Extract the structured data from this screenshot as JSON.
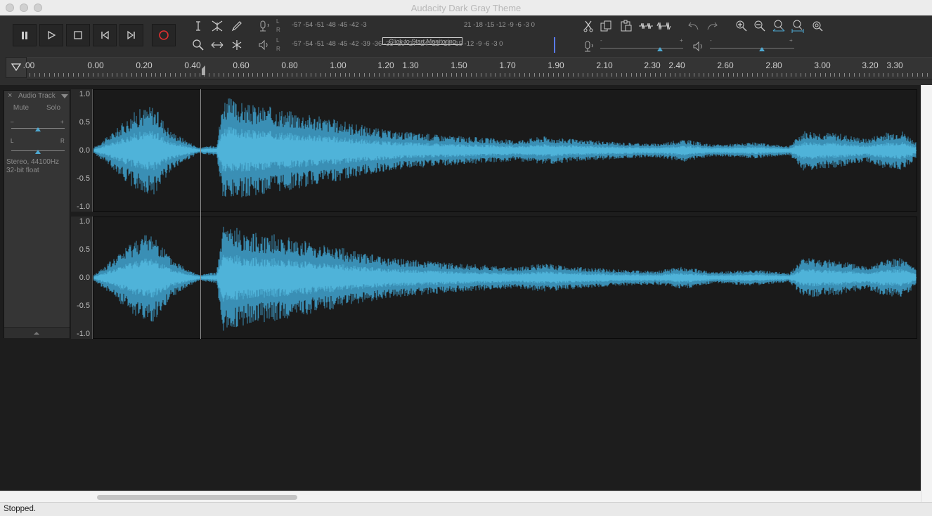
{
  "window": {
    "title": "Audacity Dark Gray Theme"
  },
  "transport": {
    "buttons": [
      {
        "name": "pause-button",
        "icon": "pause-icon"
      },
      {
        "name": "play-button",
        "icon": "play-icon"
      },
      {
        "name": "stop-button",
        "icon": "stop-icon"
      },
      {
        "name": "skip-to-start-button",
        "icon": "skip-start-icon"
      },
      {
        "name": "skip-to-end-button",
        "icon": "skip-end-icon"
      },
      {
        "name": "record-button",
        "icon": "record-icon"
      }
    ],
    "record_color": "#e03030"
  },
  "tools": [
    "selection-tool-icon",
    "envelope-tool-icon",
    "draw-tool-icon",
    "zoom-tool-icon",
    "timeshift-tool-icon",
    "multi-tool-icon"
  ],
  "meters": {
    "record_scale": "-57 -54 -51 -48 -45 -42 -3",
    "record_scale_right": "21 -18 -15 -12 -9 -6 -3 0",
    "monitor_label": "Click to Start Monitoring",
    "playback_scale": "-57 -54 -51 -48 -45 -42 -39 -36 -33 -30 -27 -24 -21 -18 -15 -12 -9 -6 -3 0",
    "left_label": "L",
    "right_label": "R"
  },
  "edit_tools": [
    "cut-icon",
    "copy-icon",
    "paste-icon",
    "trim-icon",
    "silence-icon",
    "undo-icon",
    "redo-icon",
    "zoom-in-icon",
    "zoom-out-icon",
    "fit-selection-icon",
    "fit-project-icon",
    "zoom-toggle-icon"
  ],
  "mixer": {
    "record_level": 0.72,
    "playback_level": 0.62,
    "minus": "-",
    "plus": "+"
  },
  "ruler": {
    "labels": [
      {
        "text": ".00",
        "pos": 41
      },
      {
        "text": "0.00",
        "pos": 136
      },
      {
        "text": "0.20",
        "pos": 205
      },
      {
        "text": "0.40",
        "pos": 274
      },
      {
        "text": "0.60",
        "pos": 343
      },
      {
        "text": "0.80",
        "pos": 412
      },
      {
        "text": "1.00",
        "pos": 481
      },
      {
        "text": "1.20",
        "pos": 549
      },
      {
        "text": "1.30",
        "pos": 584
      },
      {
        "text": "1.50",
        "pos": 653
      },
      {
        "text": "1.70",
        "pos": 722
      },
      {
        "text": "1.90",
        "pos": 791
      },
      {
        "text": "2.10",
        "pos": 860
      },
      {
        "text": "2.30",
        "pos": 928
      },
      {
        "text": "2.40",
        "pos": 963
      },
      {
        "text": "2.60",
        "pos": 1032
      },
      {
        "text": "2.80",
        "pos": 1101
      },
      {
        "text": "3.00",
        "pos": 1170
      },
      {
        "text": "3.20",
        "pos": 1238
      },
      {
        "text": "3.30",
        "pos": 1273
      }
    ]
  },
  "track": {
    "name": "Audio Track",
    "close": "×",
    "mute": "Mute",
    "solo": "Solo",
    "gain_minus": "–",
    "gain_plus": "+",
    "pan_left": "L",
    "pan_right": "R",
    "format_line1": "Stereo, 44100Hz",
    "format_line2": "32-bit float",
    "wave_color": "#4fb3d9",
    "wave_dark": "#3a8fb5",
    "scale": [
      "1.0",
      "0.5",
      "0.0",
      "-0.5",
      "-1.0"
    ]
  },
  "status": {
    "text": "Stopped."
  }
}
